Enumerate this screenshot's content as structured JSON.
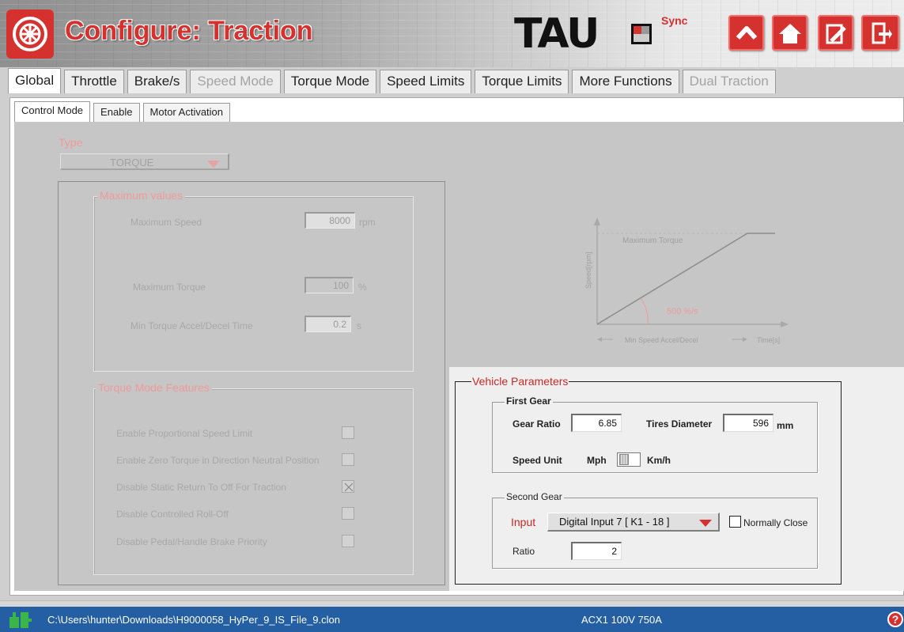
{
  "header": {
    "title": "Configure: Traction",
    "brand_text": "TAU",
    "brand_suffix": "Sync",
    "buttons": [
      "collapse-up",
      "home",
      "edit-profile",
      "exit"
    ]
  },
  "main_tabs": [
    {
      "label": "Global",
      "active": true,
      "disabled": false
    },
    {
      "label": "Throttle",
      "active": false,
      "disabled": false
    },
    {
      "label": "Brake/s",
      "active": false,
      "disabled": false
    },
    {
      "label": "Speed Mode",
      "active": false,
      "disabled": true
    },
    {
      "label": "Torque Mode",
      "active": false,
      "disabled": false
    },
    {
      "label": "Speed Limits",
      "active": false,
      "disabled": false
    },
    {
      "label": "Torque Limits",
      "active": false,
      "disabled": false
    },
    {
      "label": "More Functions",
      "active": false,
      "disabled": false
    },
    {
      "label": "Dual Traction",
      "active": false,
      "disabled": true
    }
  ],
  "sub_tabs": [
    {
      "label": "Control Mode",
      "active": true
    },
    {
      "label": "Enable",
      "active": false
    },
    {
      "label": "Motor Activation",
      "active": false
    }
  ],
  "type": {
    "label": "Type",
    "value": "TORQUE"
  },
  "max_values": {
    "title": "Maximum values",
    "max_speed_label": "Maximum Speed",
    "max_speed_value": "8000",
    "max_speed_unit": "rpm",
    "max_torque_label": "Maximum Torque",
    "max_torque_value": "100",
    "max_torque_unit": "%",
    "accel_label": "Min Torque Accel/Decel Time",
    "accel_value": "0.2",
    "accel_unit": "s"
  },
  "features": {
    "title": "Torque Mode Features",
    "items": [
      {
        "label": "Enable Proportional Speed Limit",
        "checked": false
      },
      {
        "label": "Enable Zero Torque in Direction Neutral Position",
        "checked": false
      },
      {
        "label": "Disable Static Return To Off For Traction",
        "checked": true
      },
      {
        "label": "Disable Controlled Roll-Off",
        "checked": false
      },
      {
        "label": "Disable Pedal/Handle Brake Priority",
        "checked": false
      }
    ]
  },
  "graph": {
    "ylabel": "Speed[rpm]",
    "top_label": "Maximum Torque",
    "rate_label": "500  %/s",
    "xlabel": "Min Speed Accel/Decel",
    "time_label": "Time[s]"
  },
  "vehicle": {
    "title": "Vehicle Parameters",
    "first_gear": {
      "title": "First Gear",
      "gear_ratio_label": "Gear Ratio",
      "gear_ratio_value": "6.85",
      "tires_label": "Tires Diameter",
      "tires_value": "596",
      "tires_unit": "mm",
      "speed_unit_label": "Speed Unit",
      "unit_left": "Mph",
      "unit_right": "Km/h"
    },
    "second_gear": {
      "title": "Second Gear",
      "input_label": "Input",
      "input_value": "Digital Input 7  [ K1 - 18 ]",
      "normally_close_label": "Normally Close",
      "normally_close_checked": false,
      "ratio_label": "Ratio",
      "ratio_value": "2"
    }
  },
  "status": {
    "path": "C:\\Users\\hunter\\Downloads\\H9000058_HyPer_9_IS_File_9.clon",
    "device": "ACX1 100V 750A",
    "help": "?"
  },
  "colors": {
    "accent": "#d5312e",
    "status_bar": "#245ea3"
  }
}
